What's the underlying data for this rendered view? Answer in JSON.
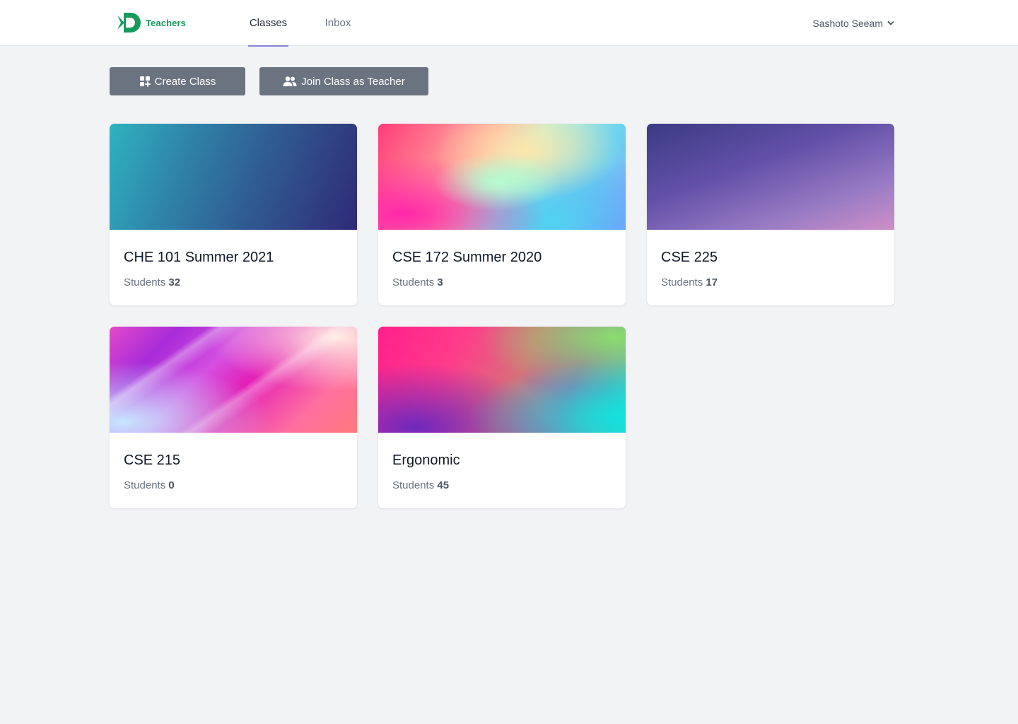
{
  "app": {
    "brand": "Teachers",
    "logo": "teachers-logo-mark",
    "brand_color": "#159a5c",
    "accent_color": "#8b83d9"
  },
  "nav": {
    "tabs": [
      {
        "label": "Classes",
        "active": true
      },
      {
        "label": "Inbox",
        "active": false
      }
    ]
  },
  "user": {
    "name": "Sashoto Seeam",
    "menu_icon": "chevron-down-icon"
  },
  "toolbar": {
    "create_label": "Create Class",
    "create_icon": "grid-plus-icon",
    "join_label": "Join Class as Teacher",
    "join_icon": "users-icon"
  },
  "classes": [
    {
      "title": "CHE 101 Summer 2021",
      "students_label": "Students",
      "students": "32"
    },
    {
      "title": "CSE 172 Summer 2020",
      "students_label": "Students",
      "students": "3"
    },
    {
      "title": "CSE 225",
      "students_label": "Students",
      "students": "17"
    },
    {
      "title": "CSE 215",
      "students_label": "Students",
      "students": "0"
    },
    {
      "title": "Ergonomic",
      "students_label": "Students",
      "students": "45"
    }
  ]
}
